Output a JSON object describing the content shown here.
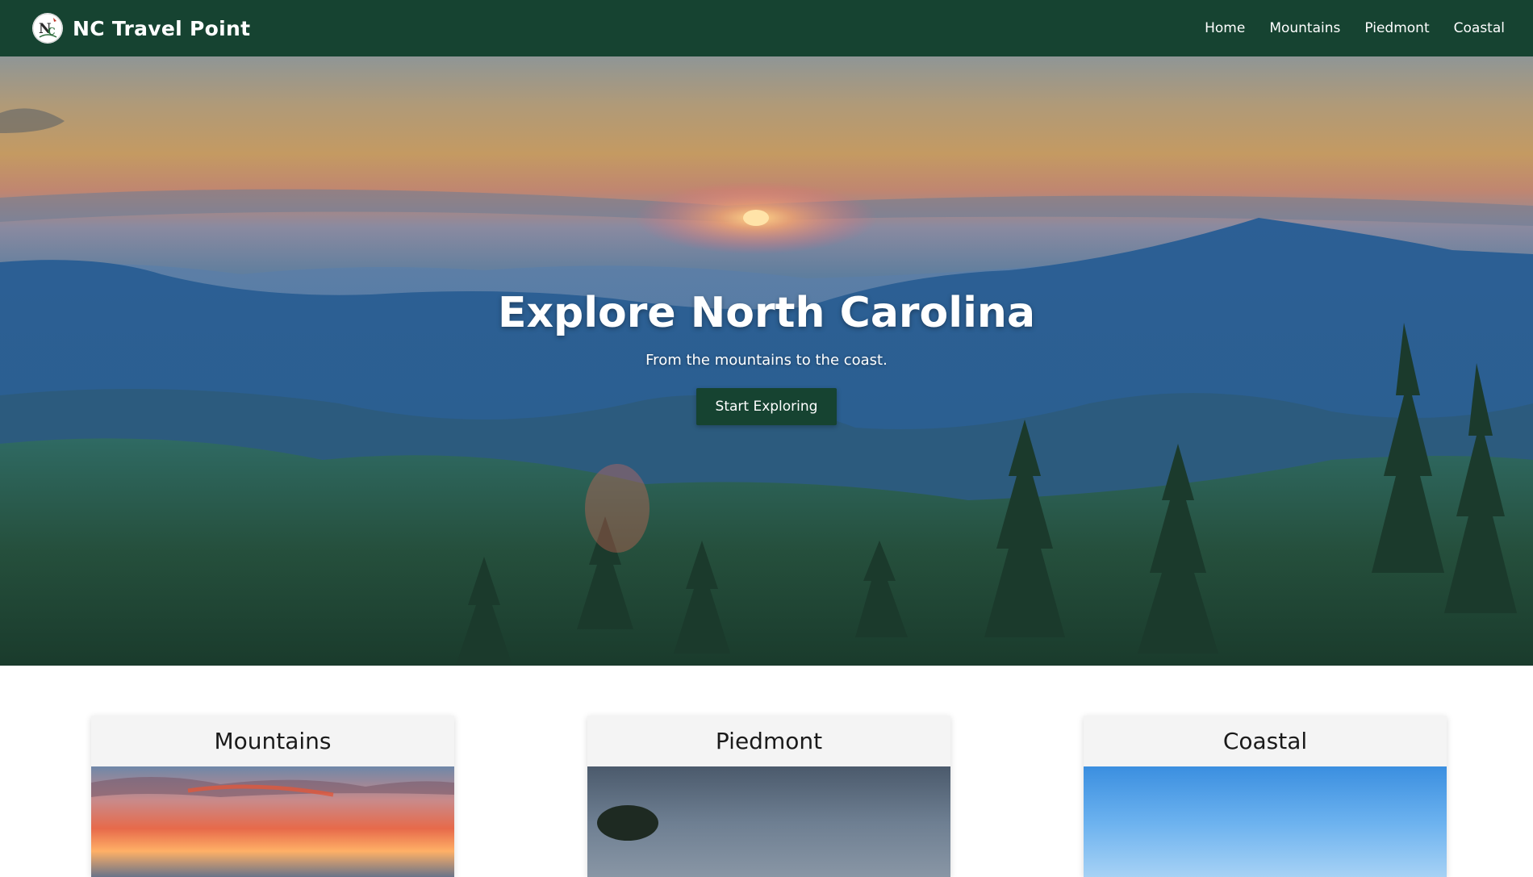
{
  "site": {
    "brand": "NC Travel Point",
    "logo_icon": "nc-logo-icon"
  },
  "nav": {
    "items": [
      {
        "label": "Home"
      },
      {
        "label": "Mountains"
      },
      {
        "label": "Piedmont"
      },
      {
        "label": "Coastal"
      }
    ]
  },
  "hero": {
    "title": "Explore North Carolina",
    "subtitle": "From the mountains to the coast.",
    "button_label": "Start Exploring"
  },
  "cards": [
    {
      "title": "Mountains"
    },
    {
      "title": "Piedmont"
    },
    {
      "title": "Coastal"
    }
  ],
  "colors": {
    "brand_green": "#164331",
    "text_white": "#ffffff",
    "card_bg": "#f4f4f4"
  }
}
